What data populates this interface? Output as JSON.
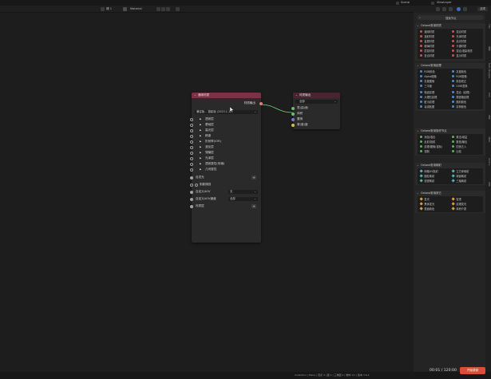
{
  "topbar": {
    "scene": "Scene",
    "viewlayer": "ViewLayer"
  },
  "toolbar": {
    "slot": "槽 1",
    "material_label": "Material"
  },
  "rtool": {
    "options": "选项"
  },
  "node_material": {
    "title": "通用材质",
    "output": "材质输出",
    "preset": "兼容版... 摄影版 (2023.1.1)",
    "rows": [
      "透射层",
      "基础层",
      "高光层",
      "精度",
      "折射率(IOR)",
      "漫反层",
      "薄膜层",
      "光泽层",
      "透射属性(传输)",
      "几何属性"
    ],
    "emission": "自发光",
    "shadow": "阴影捕捉",
    "custom_aov": "自定义AOV",
    "custom_aov_val": "无",
    "custom_aov_channel": "自定义AOV通道",
    "custom_aov_channel_val": "全部",
    "material_layer": "材质层"
  },
  "node_output": {
    "title": "材质输出",
    "dropdown": "全部",
    "rows": [
      "表(曲)面",
      "体积",
      "置换",
      "厚(度)度"
    ]
  },
  "panel": {
    "search": "搜索节点",
    "sections": [
      {
        "title": "Octane常用材质",
        "items": [
          "通用材质",
          "混合材质",
          "漫射材质",
          "光泽材质",
          "金属材质",
          "高光材质",
          "玻璃材质",
          "卡通材质",
          "层混材质",
          "混合/渲染材质",
          "复合材质",
          "显示材质"
        ]
      },
      {
        "title": "Octane常用纹理",
        "items": [
          "RGB颜色",
          "灰度颜色",
          "Alpha图像",
          "RGB图像",
          "灰度图像",
          "颜色校正",
          "三平面",
          "UVW变换",
          "噪波纹理",
          "混合（纹理）",
          "大理石纹理",
          "棋盘格纹理",
          "脏污纹理",
          "随机颜色",
          "衰减贴图",
          "实例颜色"
        ]
      },
      {
        "title": "Octane常用操作节点",
        "items": [
          "添加/混合",
          "乘法/增益",
          "反射/投射",
          "数值/输出",
          "纹理/图像(鼠标)",
          "四舍五入",
          "钳制",
          "比较"
        ]
      },
      {
        "title": "Octane常用映射",
        "items": [
          "网格UV投射",
          "立方体映射",
          "圆柱映射",
          "球面映射",
          "透视映射",
          "三轴映射"
        ]
      },
      {
        "title": "Octane常用其它",
        "items": [
          "发光",
          "权重",
          "黑体发光",
          "纹理发光",
          "表面着色",
          "体积介质"
        ]
      }
    ]
  },
  "tabs": [
    "工具",
    "视图",
    "Node Wrangler",
    "节点",
    "选项",
    "自定义",
    "Octane",
    "渲染"
  ],
  "status": {
    "text": "Collection | Plane | 顶点 4 | 面 1 | 三角面 2 | 物体 1/1 | 版本 3.6.2"
  },
  "timeline": {
    "time": "00:01",
    "total": "120:00",
    "record": "开始录制"
  }
}
